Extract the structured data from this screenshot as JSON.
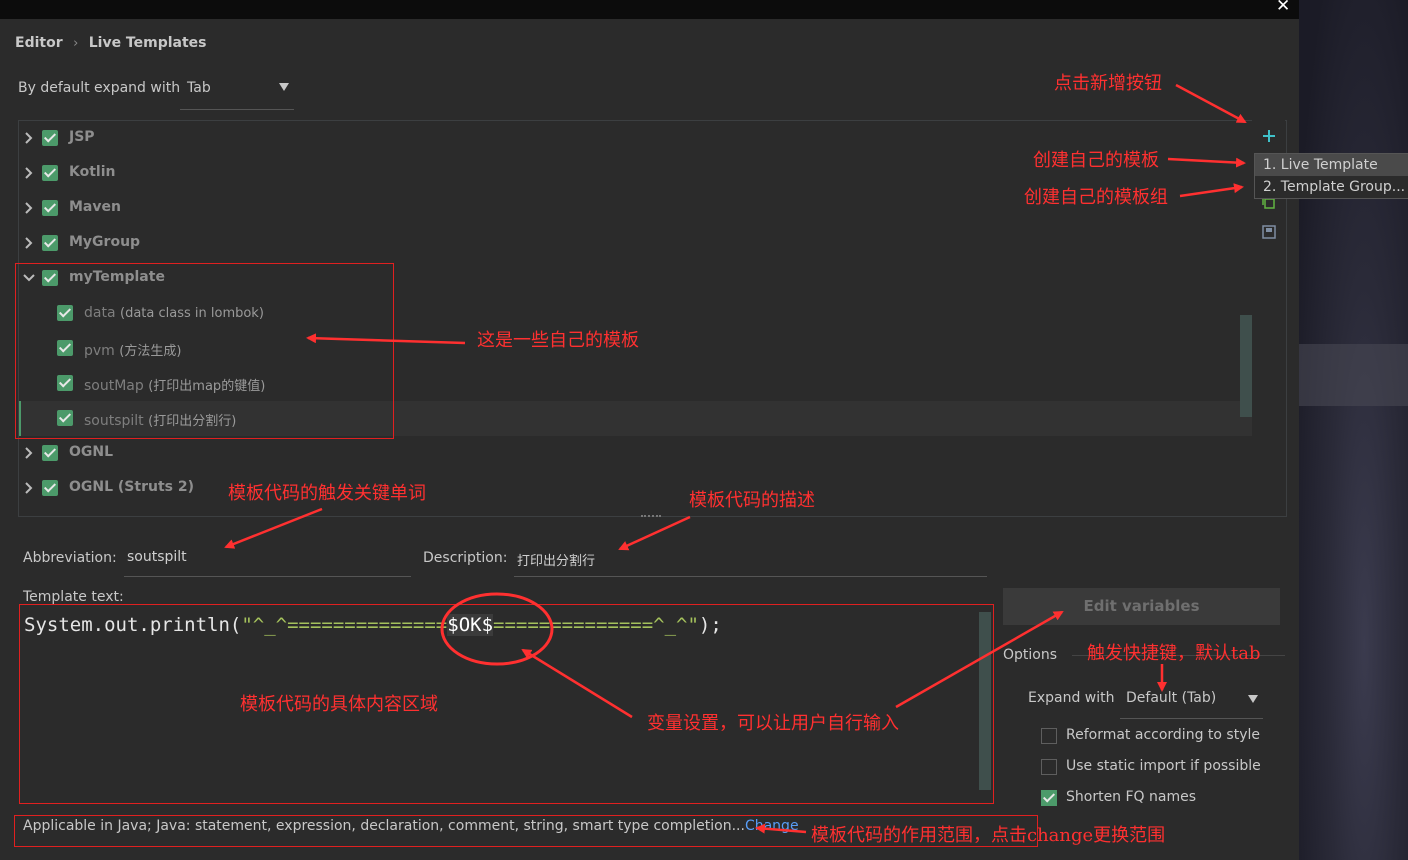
{
  "window": {
    "close_glyph": "✕"
  },
  "breadcrumb": {
    "root": "Editor",
    "sep": "›",
    "current": "Live Templates"
  },
  "expand_default": {
    "label": "By default expand with",
    "value": "Tab"
  },
  "groups": [
    {
      "name": "JSP",
      "checked": true,
      "expanded": false
    },
    {
      "name": "Kotlin",
      "checked": true,
      "expanded": false
    },
    {
      "name": "Maven",
      "checked": true,
      "expanded": false
    },
    {
      "name": "MyGroup",
      "checked": true,
      "expanded": false
    },
    {
      "name": "myTemplate",
      "checked": true,
      "expanded": true
    },
    {
      "name": "OGNL",
      "checked": true,
      "expanded": false
    },
    {
      "name": "OGNL (Struts 2)",
      "checked": true,
      "expanded": false
    }
  ],
  "templates": [
    {
      "abbr": "data",
      "desc": "(data class in lombok)"
    },
    {
      "abbr": "pvm",
      "desc": "(方法生成)"
    },
    {
      "abbr": "soutMap",
      "desc": "(打印出map的键值)"
    },
    {
      "abbr": "soutspilt",
      "desc": "(打印出分割行)"
    }
  ],
  "toolbar": {
    "add_icon": "plus-icon",
    "copy_icon": "copy-icon",
    "save_icon": "save-icon"
  },
  "add_menu": {
    "item1": "1. Live Template",
    "item2": "2. Template Group..."
  },
  "abbreviation": {
    "label": "Abbreviation:",
    "value": "soutspilt"
  },
  "description": {
    "label": "Description:",
    "value": "打印出分割行"
  },
  "template_text": {
    "label": "Template text:",
    "code_prefix": "System.out.println(",
    "code_str1": "\"^_^==============",
    "code_var": "$OK$",
    "code_str2": "==============^_^\"",
    "code_suffix": ");"
  },
  "edit_variables": "Edit variables",
  "options": {
    "title": "Options",
    "expand_label": "Expand with",
    "expand_value": "Default (Tab)",
    "reformat": "Reformat according to style",
    "static_import": "Use static import if possible",
    "shorten_fq": "Shorten FQ names",
    "reformat_checked": false,
    "static_import_checked": false,
    "shorten_fq_checked": true
  },
  "applicable": {
    "text": "Applicable in Java; Java: statement, expression, declaration, comment, string, smart type completion...",
    "link": "Change"
  },
  "annotations": {
    "add_button": "点击新增按钮",
    "own_template": "创建自己的模板",
    "own_group": "创建自己的模板组",
    "own_templates": "这是一些自己的模板",
    "trigger_word": "模板代码的触发关键单词",
    "description": "模板代码的描述",
    "content_area": "模板代码的具体内容区域",
    "variable": "变量设置，可以让用户自行输入",
    "shortcut": "触发快捷键，默认tab",
    "scope": "模板代码的作用范围，点击change更换范围"
  },
  "colors": {
    "accent_red": "#ff3030",
    "checkbox_green": "#4c9a6a",
    "link_blue": "#589df6"
  }
}
